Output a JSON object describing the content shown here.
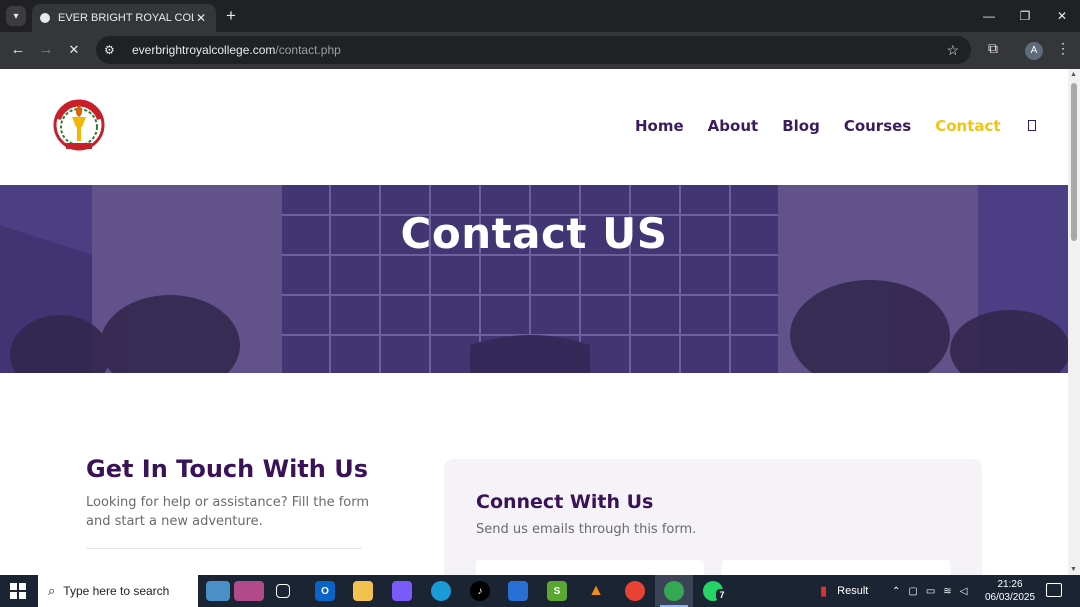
{
  "browser": {
    "tab_title": "EVER BRIGHT ROYAL COLLEGE",
    "tab_close": "✕",
    "new_tab": "+",
    "url_host": "everbrightroyalcollege.com",
    "url_path": "/contact.php",
    "profile_initial": "A",
    "window_controls": {
      "minimize": "—",
      "restore": "❐",
      "close": "✕"
    },
    "nav": {
      "back": "←",
      "forward": "→",
      "stop": "✕"
    }
  },
  "site": {
    "nav_items": [
      {
        "label": "Home"
      },
      {
        "label": "About"
      },
      {
        "label": "Blog"
      },
      {
        "label": "Courses"
      },
      {
        "label": "Contact"
      }
    ],
    "active_nav": "Contact",
    "colors": {
      "primary": "#3b1c5c",
      "accent": "#f2c40f",
      "hero_overlay": "#4a3a78"
    }
  },
  "hero": {
    "title": "Contact US"
  },
  "contact": {
    "heading": "Get In Touch With Us",
    "text": "Looking for help or assistance? Fill the form and start a new adventure.",
    "card_title": "Connect With Us",
    "card_subtitle": "Send us emails through this form."
  },
  "taskbar": {
    "search_placeholder": "Type here to search",
    "whatsapp_badge": "7",
    "weather_label": "Result",
    "time": "21:26",
    "date": "06/03/2025"
  }
}
